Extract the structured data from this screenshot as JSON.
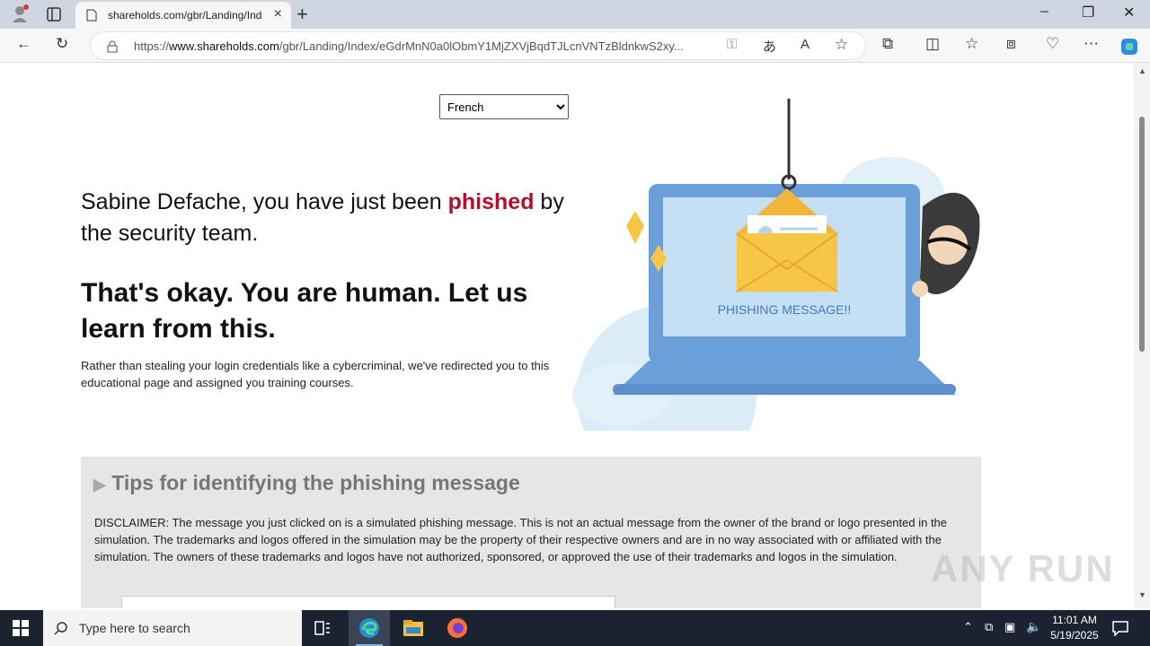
{
  "browser": {
    "tab_title": "shareholds.com/gbr/Landing/Ind",
    "url_prefix": "https://",
    "url_domain": "www.shareholds.com",
    "url_path": "/gbr/Landing/Index/eGdrMnN0a0lObmY1MjZXVjBqdTJLcnVNTzBldnkwS2xy..."
  },
  "page": {
    "language_selected": "French",
    "headline_pre": "Sabine Defache, you have just been ",
    "headline_red": "phished",
    "headline_post": " by the security team.",
    "subheadline": "That's okay. You are human. Let us learn from this.",
    "body": "Rather than stealing your login credentials like a cybercriminal, we've redirected you to this educational page and assigned you training courses.",
    "illustration_text": "PHISHING MESSAGE!!",
    "tips_heading": "Tips for identifying the phishing message",
    "disclaimer": "DISCLAIMER: The message you just clicked on is a simulated phishing message. This is not an actual message from the owner of the brand or logo presented in the simulation. The trademarks and logos offered in the simulation may be the property of their respective owners and are in no way associated with or affiliated with the simulation. The owners of these trademarks and logos have not authorized, sponsored, or approved the use of their trademarks and logos in the simulation."
  },
  "watermark": "ANY RUN",
  "taskbar": {
    "search_placeholder": "Type here to search",
    "time": "11:01 AM",
    "date": "5/19/2025"
  },
  "colors": {
    "accent_red": "#b0102b",
    "laptop_blue": "#6b9fd9",
    "envelope_yellow": "#f7c646"
  }
}
